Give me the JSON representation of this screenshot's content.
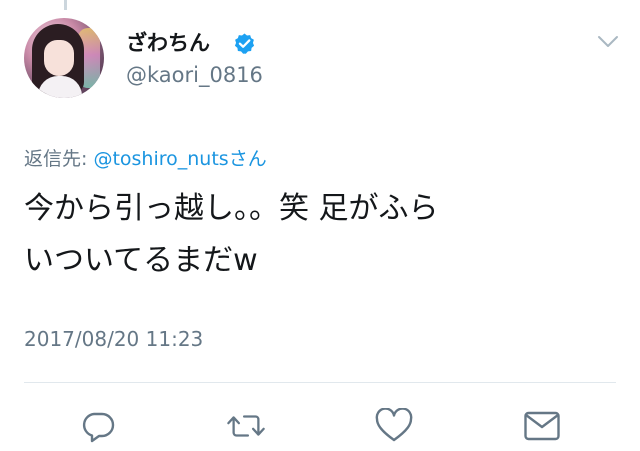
{
  "tweet": {
    "display_name": "ざわちん",
    "verified": true,
    "handle": "@kaori_0816",
    "reply_prefix": "返信先: ",
    "reply_mention": "@toshiro_nuts",
    "reply_suffix": "さん",
    "text_lines": [
      "今から引っ越し。。笑 足がふら",
      "いついてるまだw"
    ],
    "timestamp": "2017/08/20 11:23"
  },
  "actions": [
    {
      "icon": "reply-icon"
    },
    {
      "icon": "retweet-icon"
    },
    {
      "icon": "like-icon"
    },
    {
      "icon": "direct-message-icon"
    }
  ],
  "colors": {
    "text": "#14171a",
    "secondary": "#657786",
    "link": "#1b95e0",
    "verified": "#1da1f2",
    "divider": "#e1e8ed"
  }
}
